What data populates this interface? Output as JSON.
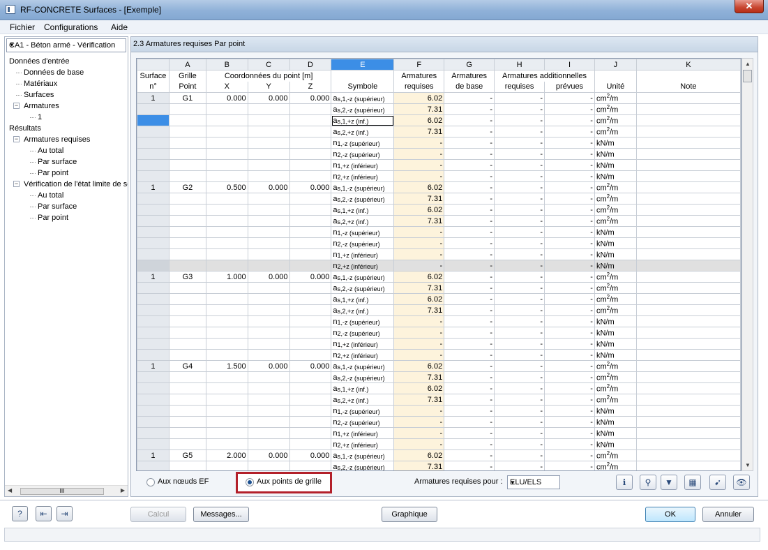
{
  "window": {
    "title": "RF-CONCRETE Surfaces - [Exemple]",
    "close": "✕"
  },
  "menu": [
    "Fichier",
    "Configurations",
    "Aide"
  ],
  "case_select": "CA1 - Béton armé - Vérification",
  "tree": [
    {
      "label": "Données d'entrée",
      "level": 0
    },
    {
      "label": "Données de base",
      "level": 1
    },
    {
      "label": "Matériaux",
      "level": 1
    },
    {
      "label": "Surfaces",
      "level": 1
    },
    {
      "label": "Armatures",
      "level": 1,
      "toggle": "−"
    },
    {
      "label": "1",
      "level": 2
    },
    {
      "label": "Résultats",
      "level": 0
    },
    {
      "label": "Armatures requises",
      "level": 1,
      "toggle": "−"
    },
    {
      "label": "Au total",
      "level": 2
    },
    {
      "label": "Par surface",
      "level": 2
    },
    {
      "label": "Par point",
      "level": 2
    },
    {
      "label": "Vérification de l'état limite de se",
      "level": 1,
      "toggle": "−"
    },
    {
      "label": "Au total",
      "level": 2
    },
    {
      "label": "Par surface",
      "level": 2
    },
    {
      "label": "Par point",
      "level": 2
    }
  ],
  "panel_title": "2.3 Armatures requises Par point",
  "table": {
    "letters": [
      "",
      "A",
      "B",
      "C",
      "D",
      "E",
      "F",
      "G",
      "H",
      "I",
      "J",
      "K"
    ],
    "header1": {
      "surface": "Surface",
      "grille": "Grille",
      "coords": "Coordonnées du point [m]",
      "arm_req": "Armatures",
      "arm_base": "Armatures",
      "arm_add": "Armatures additionnelles"
    },
    "header2": {
      "surface": "n°",
      "point": "Point",
      "x": "X",
      "y": "Y",
      "z": "Z",
      "symbole": "Symbole",
      "arm_req": "requises",
      "arm_base": "de base",
      "add_req": "requises",
      "add_prev": "prévues",
      "unite": "Unité",
      "note": "Note"
    },
    "symbols": [
      {
        "a": "a",
        "sub": "s,1,-z (supérieur)",
        "val": "6.02",
        "unit": "cm",
        "sup": "2",
        "per": "/m"
      },
      {
        "a": "a",
        "sub": "s,2,-z (supérieur)",
        "val": "7.31",
        "unit": "cm",
        "sup": "2",
        "per": "/m"
      },
      {
        "a": "a",
        "sub": "s,1,+z (inf.)",
        "val": "6.02",
        "unit": "cm",
        "sup": "2",
        "per": "/m"
      },
      {
        "a": "a",
        "sub": "s,2,+z (inf.)",
        "val": "7.31",
        "unit": "cm",
        "sup": "2",
        "per": "/m"
      },
      {
        "a": "n",
        "sub": "1,-z (supérieur)",
        "val": "-",
        "unit": "kN/m",
        "sup": "",
        "per": ""
      },
      {
        "a": "n",
        "sub": "2,-z (supérieur)",
        "val": "-",
        "unit": "kN/m",
        "sup": "",
        "per": ""
      },
      {
        "a": "n",
        "sub": "1,+z (inférieur)",
        "val": "-",
        "unit": "kN/m",
        "sup": "",
        "per": ""
      },
      {
        "a": "n",
        "sub": "2,+z (inférieur)",
        "val": "-",
        "unit": "kN/m",
        "sup": "",
        "per": ""
      }
    ],
    "dash": "-",
    "points": [
      {
        "surface": "1",
        "point": "G1",
        "x": "0.000",
        "y": "0.000",
        "z": "0.000"
      },
      {
        "surface": "1",
        "point": "G2",
        "x": "0.500",
        "y": "0.000",
        "z": "0.000"
      },
      {
        "surface": "1",
        "point": "G3",
        "x": "1.000",
        "y": "0.000",
        "z": "0.000"
      },
      {
        "surface": "1",
        "point": "G4",
        "x": "1.500",
        "y": "0.000",
        "z": "0.000"
      },
      {
        "surface": "1",
        "point": "G5",
        "x": "2.000",
        "y": "0.000",
        "z": "0.000"
      }
    ]
  },
  "bottom": {
    "radio1": "Aux nœuds EF",
    "radio2": "Aux points de grille",
    "arm_label": "Armatures requises pour :",
    "arm_select": "ELU/ELS",
    "icons": [
      "ℹ",
      "⚲",
      "▼",
      "▦",
      "➹",
      "👁"
    ]
  },
  "footer": {
    "sbtn": [
      "?",
      "⇤",
      "⇥"
    ],
    "calcul": "Calcul",
    "messages": "Messages...",
    "graphique": "Graphique",
    "ok": "OK",
    "annuler": "Annuler"
  },
  "scroll": {
    "up": "▲",
    "down": "▼",
    "left": "◀",
    "right": "▶",
    "grip": "III",
    "dropdown": "▼"
  }
}
